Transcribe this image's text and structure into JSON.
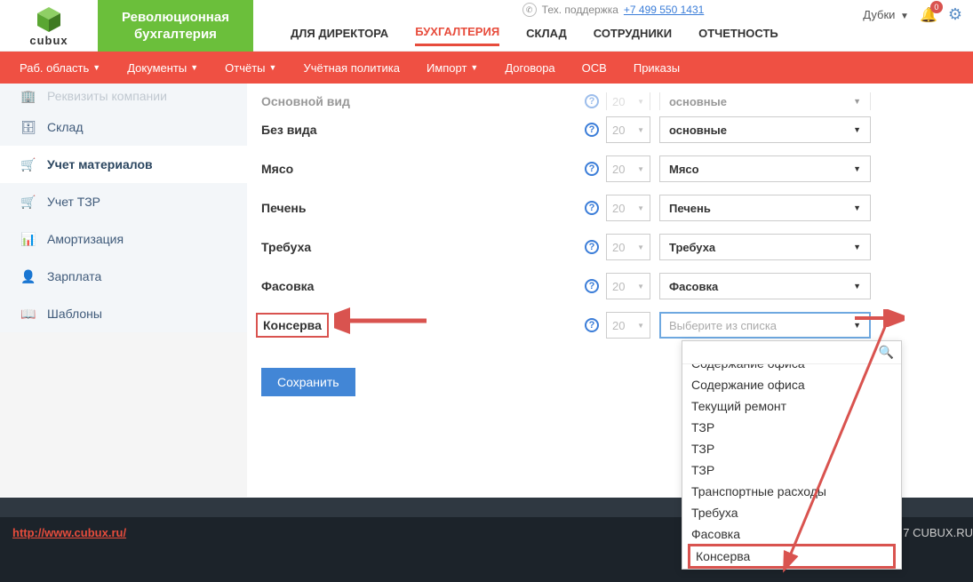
{
  "brand": {
    "logo": "cubux",
    "tagline1": "Революционная",
    "tagline2": "бухгалтерия"
  },
  "support": {
    "label": "Тех. поддержка",
    "phone": "+7 499 550 1431"
  },
  "topActions": {
    "org": "Дубки",
    "notifCount": "0"
  },
  "mainNav": {
    "director": "ДЛЯ ДИРЕКТОРА",
    "accounting": "БУХГАЛТЕРИЯ",
    "stock": "СКЛАД",
    "employees": "СОТРУДНИКИ",
    "reports": "ОТЧЕТНОСТЬ"
  },
  "subNav": {
    "workspace": "Раб. область",
    "documents": "Документы",
    "reports": "Отчёты",
    "policy": "Учётная политика",
    "import": "Импорт",
    "contracts": "Договора",
    "osv": "ОСВ",
    "orders": "Приказы"
  },
  "sidebar": {
    "cutoff": "Реквизиты компании",
    "stock": "Склад",
    "materials": "Учет материалов",
    "tzr": "Учет ТЗР",
    "amort": "Амортизация",
    "salary": "Зарплата",
    "templates": "Шаблоны"
  },
  "rows": [
    {
      "label": "Основной вид",
      "num": "20",
      "select": "основные",
      "placeholder": false
    },
    {
      "label": "Без вида",
      "num": "20",
      "select": "основные",
      "placeholder": false
    },
    {
      "label": "Мясо",
      "num": "20",
      "select": "Мясо",
      "placeholder": false
    },
    {
      "label": "Печень",
      "num": "20",
      "select": "Печень",
      "placeholder": false
    },
    {
      "label": "Требуха",
      "num": "20",
      "select": "Требуха",
      "placeholder": false
    },
    {
      "label": "Фасовка",
      "num": "20",
      "select": "Фасовка",
      "placeholder": false
    },
    {
      "label": "Консерва",
      "num": "20",
      "select": "Выберите из списка",
      "placeholder": true
    }
  ],
  "saveBtn": "Сохранить",
  "dropdown": {
    "options": [
      "Содержание офиса",
      "Содержание офиса",
      "Текущий ремонт",
      "ТЗР",
      "ТЗР",
      "ТЗР",
      "Транспортные расходы",
      "Требуха",
      "Фасовка",
      "Консерва"
    ],
    "highlightIndex": 9
  },
  "footer": {
    "url": "http://www.cubux.ru/",
    "copy": "7 CUBUX.RU"
  }
}
